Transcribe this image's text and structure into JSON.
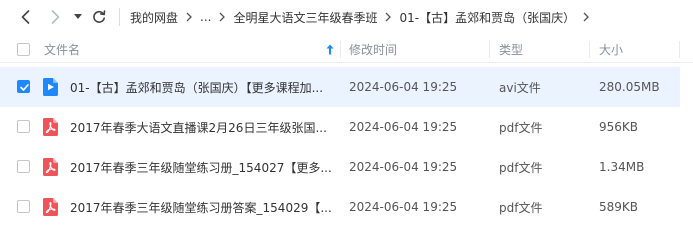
{
  "nav": {
    "back_icon": "chevron-left-icon",
    "forward_icon": "chevron-right-icon",
    "history_icon": "caret-down-icon",
    "refresh_icon": "refresh-icon"
  },
  "breadcrumb": {
    "root": "我的网盘",
    "ellipsis": "...",
    "parent": "全明星大语文三年级春季班",
    "current": "01-【古】孟郊和贾岛（张国庆）"
  },
  "table": {
    "headers": {
      "name": "文件名",
      "modified": "修改时间",
      "type": "类型",
      "size": "大小"
    },
    "sort_icon": "sort-ascending-icon",
    "rows": [
      {
        "name": "01-【古】孟郊和贾岛（张国庆）【更多课程加...",
        "modified": "2024-06-04 19:25",
        "type": "avi文件",
        "size": "280.05MB",
        "icon": "video-file-icon",
        "selected": true
      },
      {
        "name": "2017年春季大语文直播课2月26日三年级张国...",
        "modified": "2024-06-04 19:25",
        "type": "pdf文件",
        "size": "956KB",
        "icon": "pdf-file-icon",
        "selected": false
      },
      {
        "name": "2017年春季三年级随堂练习册_154027【更多...",
        "modified": "2024-06-04 19:25",
        "type": "pdf文件",
        "size": "1.34MB",
        "icon": "pdf-file-icon",
        "selected": false
      },
      {
        "name": "2017年春季三年级随堂练习册答案_154029【...",
        "modified": "2024-06-04 19:25",
        "type": "pdf文件",
        "size": "589KB",
        "icon": "pdf-file-icon",
        "selected": false
      }
    ]
  },
  "colors": {
    "accent": "#1e88ff",
    "selected_row": "#eaf3ff",
    "video_icon": "#1e88ff",
    "pdf_icon": "#f0545a"
  }
}
